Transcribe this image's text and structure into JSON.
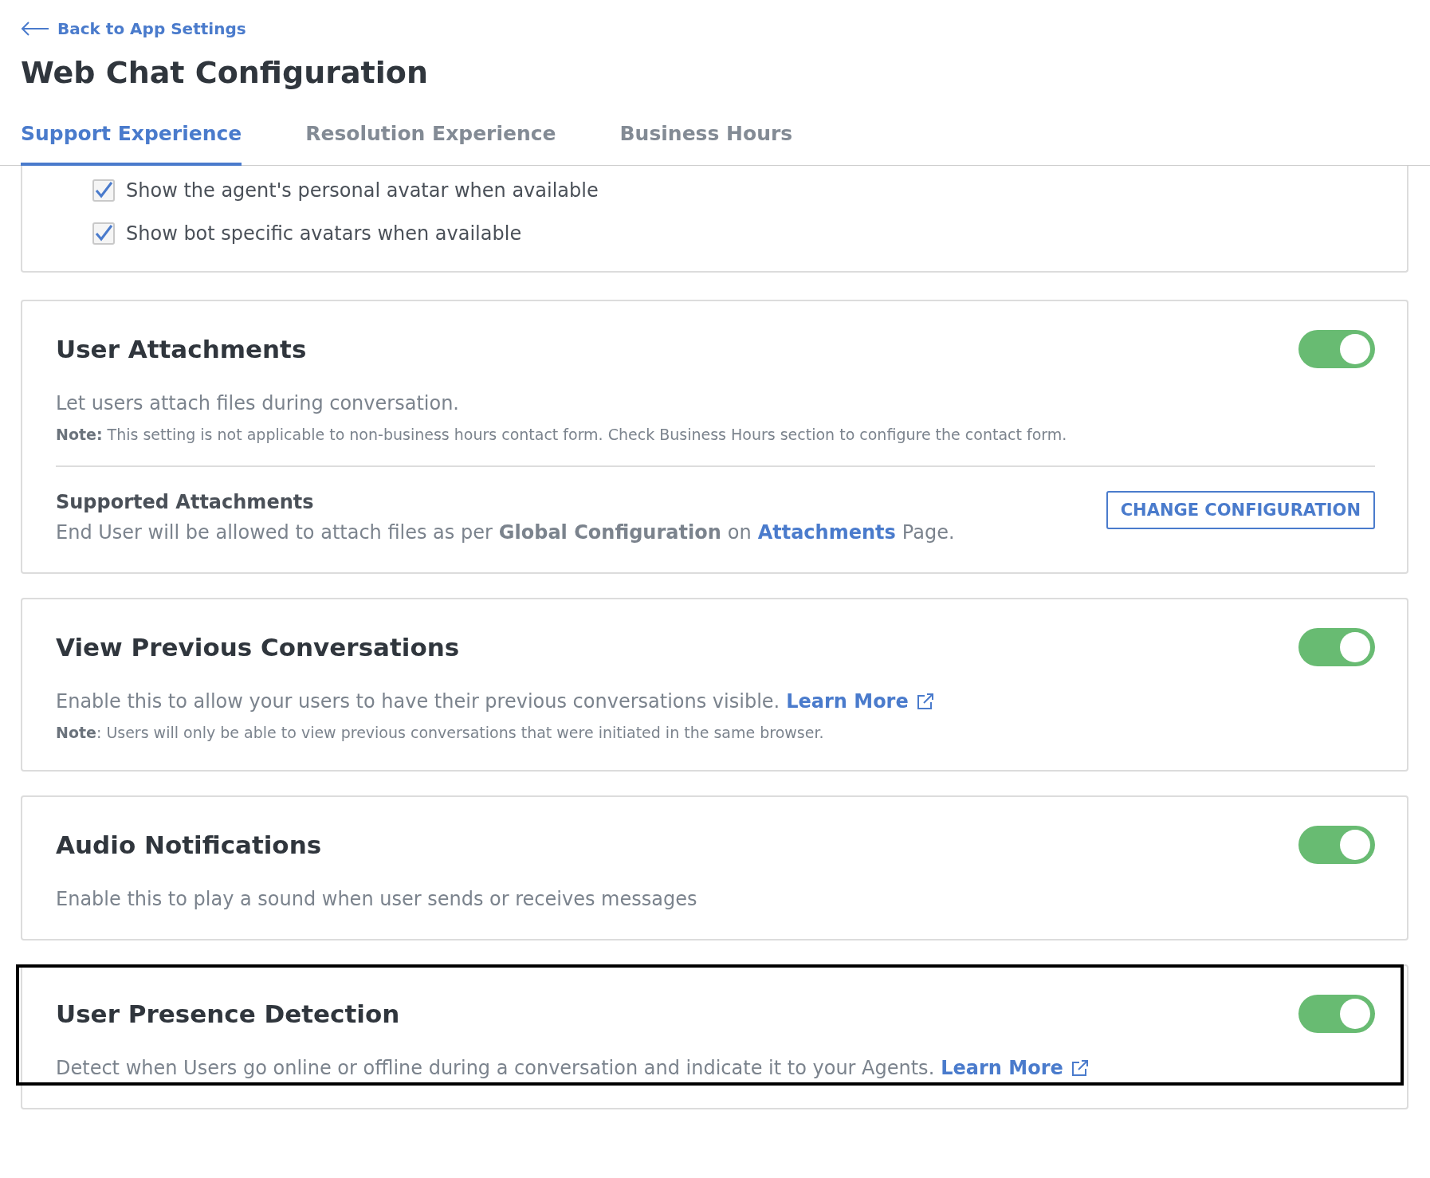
{
  "back_link": "Back to App Settings",
  "title": "Web Chat Configuration",
  "tabs": [
    {
      "label": "Support Experience",
      "selected": true
    },
    {
      "label": "Resolution Experience",
      "selected": false
    },
    {
      "label": "Business Hours",
      "selected": false
    }
  ],
  "avatar_options": [
    {
      "label": "Show the agent's personal avatar when available",
      "checked": true
    },
    {
      "label": "Show bot specific avatars when available",
      "checked": true
    }
  ],
  "sections": [
    {
      "title": "User Attachments",
      "on": true,
      "description": [
        {
          "kind": "text",
          "text": "Let users attach files during conversation."
        }
      ],
      "note": "**Note:** This setting is not applicable to non-business hours contact form. Check Business Hours section to configure the contact form.",
      "sub": {
        "title": "Supported Attachments",
        "button": "CHANGE CONFIGURATION",
        "description": [
          {
            "kind": "text",
            "text": "End User will be allowed to attach files as per"
          },
          {
            "kind": "bold",
            "text": "Global Configuration"
          },
          {
            "kind": "text",
            "text": "on"
          },
          {
            "kind": "link",
            "text": "Attachments"
          },
          {
            "kind": "text",
            "text": "Page."
          }
        ]
      }
    },
    {
      "title": "View Previous Conversations",
      "on": true,
      "description": [
        {
          "kind": "text",
          "text": "Enable this to allow your users to have their previous conversations visible."
        },
        {
          "kind": "external_link",
          "text": "Learn More"
        }
      ],
      "note": "**Note**: Users will only be able to view previous conversations that were initiated in the same browser."
    },
    {
      "title": "Audio Notifications",
      "on": true,
      "description": [
        {
          "kind": "text",
          "text": "Enable this to play a sound when user sends or receives messages"
        }
      ]
    },
    {
      "title": "User Presence Detection",
      "on": true,
      "highlighted": true,
      "description": [
        {
          "kind": "text",
          "text": "Detect when Users go online or offline during a conversation and indicate it to your Agents."
        },
        {
          "kind": "external_link",
          "text": "Learn More"
        }
      ]
    }
  ]
}
